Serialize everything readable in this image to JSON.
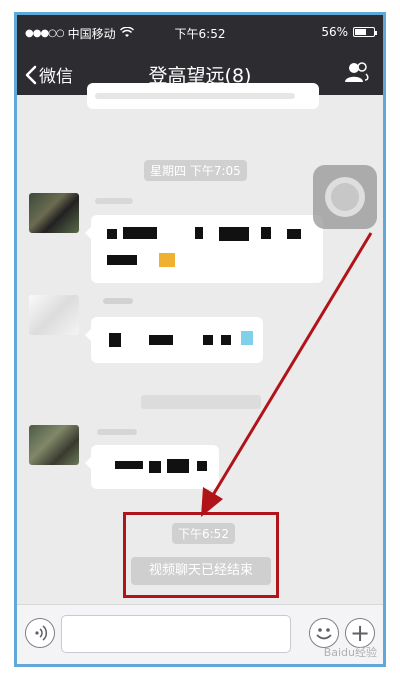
{
  "status_bar": {
    "signal": "●●●○○",
    "carrier": "中国移动",
    "wifi_icon": "wifi-icon",
    "time": "下午6:52",
    "battery_percent": "56%",
    "battery_level": 0.56
  },
  "nav": {
    "back_label": "微信",
    "title": "登高望远(8)",
    "contacts_icon": "group-contacts-icon"
  },
  "chat": {
    "timestamps": [
      {
        "label": "星期四 下午7:05"
      },
      {
        "label": "下午6:52"
      }
    ],
    "system_message": "视频聊天已经结束"
  },
  "input_bar": {
    "placeholder": "",
    "value": ""
  },
  "colors": {
    "nav_bg": "#2d2d31",
    "chat_bg": "#ebebeb",
    "highlight": "#b01318",
    "arrow": "#b01318",
    "frame": "#5fa8d8"
  },
  "watermark": "Baidu经验"
}
